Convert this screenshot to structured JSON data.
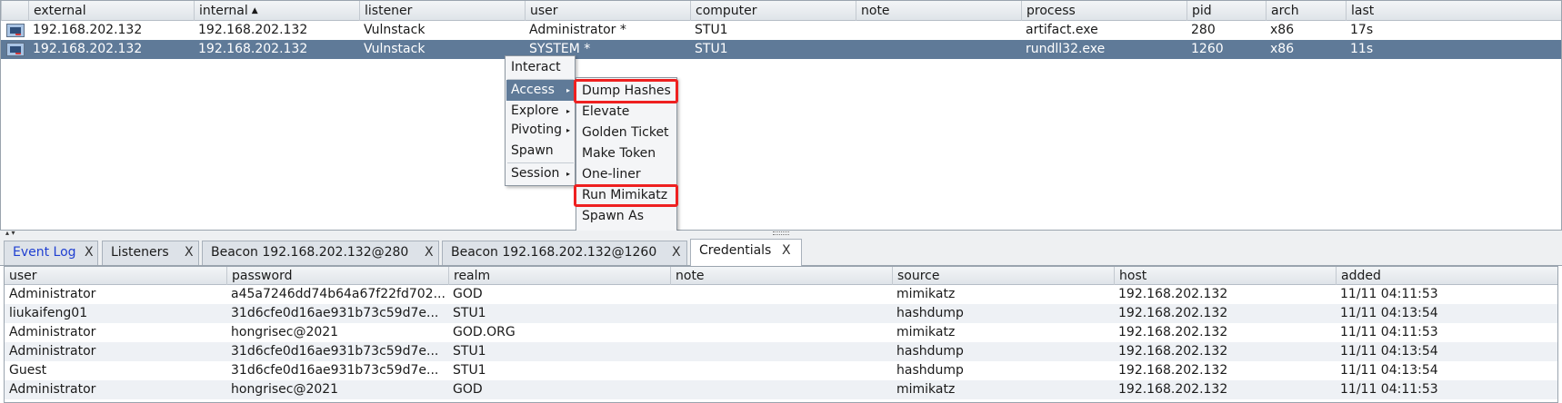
{
  "sessions": {
    "columns": [
      "external",
      "internal",
      "listener",
      "user",
      "computer",
      "note",
      "process",
      "pid",
      "arch",
      "last"
    ],
    "sorted_column": "internal",
    "sort_arrow": "▲",
    "rows": [
      {
        "external": "192.168.202.132",
        "internal": "192.168.202.132",
        "listener": "Vulnstack",
        "user": "Administrator *",
        "computer": "STU1",
        "note": "",
        "process": "artifact.exe",
        "pid": "280",
        "arch": "x86",
        "last": "17s",
        "icon": "beacon-session-icon"
      },
      {
        "external": "192.168.202.132",
        "internal": "192.168.202.132",
        "listener": "Vulnstack",
        "user": "SYSTEM *",
        "computer": "STU1",
        "note": "",
        "process": "rundll32.exe",
        "pid": "1260",
        "arch": "x86",
        "last": "11s",
        "icon": "beacon-session-icon"
      }
    ]
  },
  "context_menu": {
    "items": [
      {
        "label": "Interact",
        "has_submenu": false
      },
      {
        "label": "Access",
        "has_submenu": true,
        "active": true
      },
      {
        "label": "Explore",
        "has_submenu": true
      },
      {
        "label": "Pivoting",
        "has_submenu": true
      },
      {
        "label": "Spawn",
        "has_submenu": false
      },
      {
        "label": "Session",
        "has_submenu": true
      }
    ],
    "submenu_arrow": "▸",
    "access_submenu": [
      {
        "label": "Dump Hashes",
        "highlighted": true
      },
      {
        "label": "Elevate"
      },
      {
        "label": "Golden Ticket"
      },
      {
        "label": "Make Token"
      },
      {
        "label": "One-liner"
      },
      {
        "label": "Run Mimikatz",
        "highlighted": true
      },
      {
        "label": "Spawn As"
      }
    ]
  },
  "splitter": {
    "arrows": "▴ ▾"
  },
  "tabs": [
    {
      "label": "Event Log",
      "close": "X"
    },
    {
      "label": "Listeners",
      "close": "X"
    },
    {
      "label": "Beacon 192.168.202.132@280",
      "close": "X"
    },
    {
      "label": "Beacon 192.168.202.132@1260",
      "close": "X"
    },
    {
      "label": "Credentials",
      "close": "X",
      "active": true
    }
  ],
  "credentials": {
    "columns": [
      "user",
      "password",
      "realm",
      "note",
      "source",
      "host",
      "added"
    ],
    "rows": [
      {
        "user": "Administrator",
        "password": "a45a7246dd74b64a67f22fd702...",
        "realm": "GOD",
        "note": "",
        "source": "mimikatz",
        "host": "192.168.202.132",
        "added": "11/11 04:11:53"
      },
      {
        "user": "liukaifeng01",
        "password": "31d6cfe0d16ae931b73c59d7e...",
        "realm": "STU1",
        "note": "",
        "source": "hashdump",
        "host": "192.168.202.132",
        "added": "11/11 04:13:54"
      },
      {
        "user": "Administrator",
        "password": "hongrisec@2021",
        "realm": "GOD.ORG",
        "note": "",
        "source": "mimikatz",
        "host": "192.168.202.132",
        "added": "11/11 04:11:53"
      },
      {
        "user": "Administrator",
        "password": "31d6cfe0d16ae931b73c59d7e...",
        "realm": "STU1",
        "note": "",
        "source": "hashdump",
        "host": "192.168.202.132",
        "added": "11/11 04:13:54"
      },
      {
        "user": "Guest",
        "password": "31d6cfe0d16ae931b73c59d7e...",
        "realm": "STU1",
        "note": "",
        "source": "hashdump",
        "host": "192.168.202.132",
        "added": "11/11 04:13:54"
      },
      {
        "user": "Administrator",
        "password": "hongrisec@2021",
        "realm": "GOD",
        "note": "",
        "source": "mimikatz",
        "host": "192.168.202.132",
        "added": "11/11 04:11:53"
      }
    ]
  },
  "colors": {
    "selection": "#5f7a98",
    "highlight_box": "#ee2020",
    "event_log_tab_text": "#1f3fd1"
  }
}
